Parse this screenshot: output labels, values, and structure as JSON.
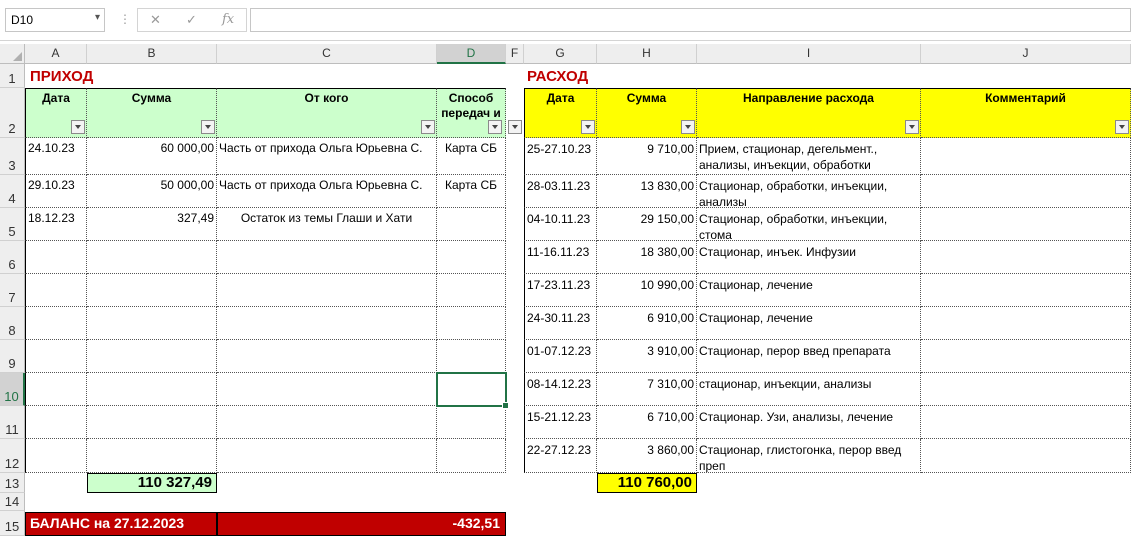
{
  "formula_bar": {
    "name_box": "D10",
    "formula": ""
  },
  "columns": [
    "A",
    "B",
    "C",
    "D",
    "F",
    "G",
    "H",
    "I",
    "J"
  ],
  "rows": [
    "1",
    "2",
    "3",
    "4",
    "5",
    "6",
    "7",
    "8",
    "9",
    "10",
    "11",
    "12",
    "13",
    "14",
    "15"
  ],
  "income": {
    "title": "ПРИХОД",
    "headers": [
      "Дата",
      "Сумма",
      "От кого",
      "Способ передач и"
    ],
    "rows": [
      [
        "24.10.23",
        "60 000,00",
        "Часть от прихода Ольга Юрьевна С.",
        "Карта СБ"
      ],
      [
        "29.10.23",
        "50 000,00",
        "Часть от прихода Ольга Юрьевна С.",
        "Карта СБ"
      ],
      [
        "18.12.23",
        "327,49",
        "Остаток из темы Глаши и Хати",
        ""
      ]
    ],
    "total": "110 327,49"
  },
  "expense": {
    "title": "РАСХОД",
    "headers": [
      "Дата",
      "Сумма",
      "Направление расхода",
      "Комментарий"
    ],
    "rows": [
      [
        "25-27.10.23",
        "9 710,00",
        "Прием, стационар, дегельмент., анализы, инъекции, обработки",
        ""
      ],
      [
        "28-03.11.23",
        "13 830,00",
        "Стационар, обработки, инъекции, анализы",
        ""
      ],
      [
        "04-10.11.23",
        "29 150,00",
        "Стационар, обработки, инъекции, стома",
        ""
      ],
      [
        "11-16.11.23",
        "18 380,00",
        "Стационар, инъек. Инфузии",
        ""
      ],
      [
        "17-23.11.23",
        "10 990,00",
        "Стационар, лечение",
        ""
      ],
      [
        "24-30.11.23",
        "6 910,00",
        "Стационар, лечение",
        ""
      ],
      [
        "01-07.12.23",
        "3 910,00",
        "Стационар, перор введ препарата",
        ""
      ],
      [
        "08-14.12.23",
        "7 310,00",
        "стационар, инъекции, анализы",
        ""
      ],
      [
        "15-21.12.23",
        "6 710,00",
        "Стационар. Узи, анализы, лечение",
        ""
      ],
      [
        "22-27.12.23",
        "3 860,00",
        "Стационар, глистогонка, перор введ преп",
        ""
      ]
    ],
    "total": "110 760,00"
  },
  "balance": {
    "label": "БАЛАНС на 27.12.2023",
    "value": "-432,51"
  },
  "colors": {
    "income_header": "#ccffcc",
    "expense_header": "#ffff00",
    "title_red": "#c00000",
    "balance_bg": "#c00000",
    "selection": "#217346"
  }
}
